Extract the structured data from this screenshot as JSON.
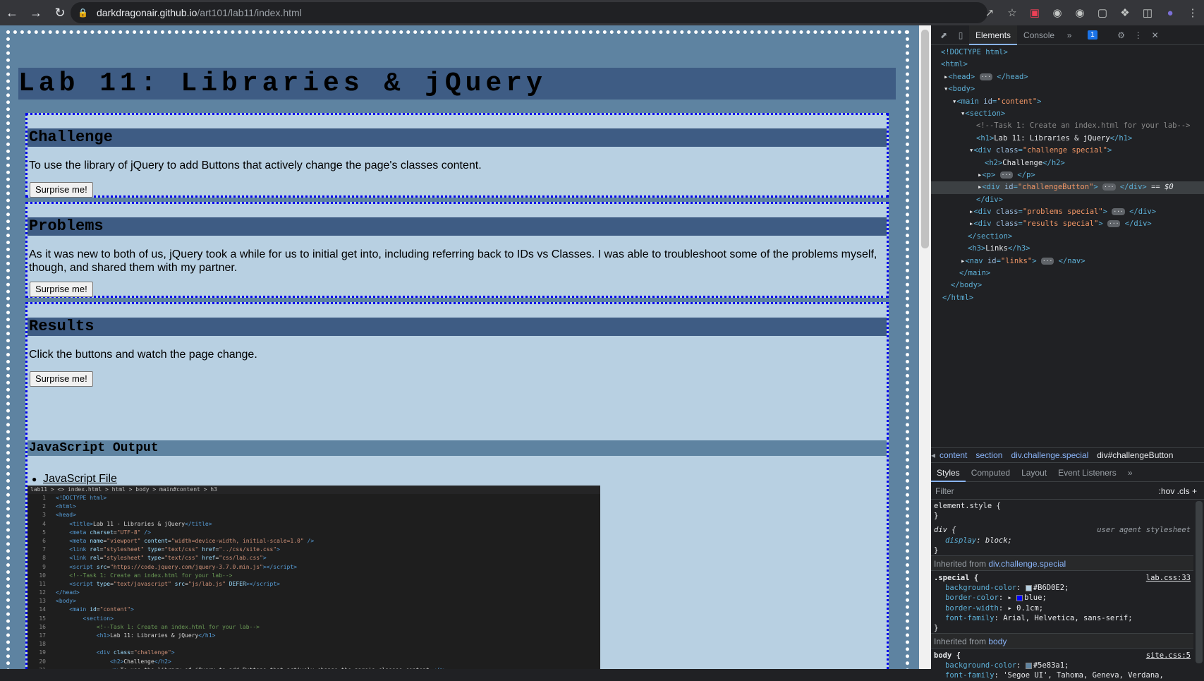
{
  "browser": {
    "url_host": "darkdragonair.github.io",
    "url_path": "/art101/lab11/index.html"
  },
  "page": {
    "title": "Lab 11: Libraries & jQuery",
    "sections": [
      {
        "heading": "Challenge",
        "text": "To use the library of jQuery to add Buttons that actively change the page's classes content.",
        "button": "Surprise me!"
      },
      {
        "heading": "Problems",
        "text": "As it was new to both of us, jQuery took a while for us to initial get into, including referring back to IDs vs Classes. I was able to troubleshoot some of the problems myself, though, and shared them with my partner.",
        "button": "Surprise me!"
      },
      {
        "heading": "Results",
        "text": "Click the buttons and watch the page change.",
        "button": "Surprise me!"
      }
    ],
    "js_output_heading": "JavaScript Output",
    "js_link": "JavaScript File",
    "code_breadcrumb": "lab11 > <> index.html > html > body > main#content > h3"
  },
  "devtools": {
    "tabs": [
      "Elements",
      "Console"
    ],
    "active_tab": "Elements",
    "issues_badge": "1",
    "breadcrumbs": [
      "content",
      "section",
      "div.challenge.special",
      "div#challengeButton"
    ],
    "style_tabs": [
      "Styles",
      "Computed",
      "Layout",
      "Event Listeners"
    ],
    "filter_placeholder": "Filter",
    "filter_tools": ":hov  .cls  +",
    "element_style": "element.style {",
    "div_rule": {
      "selector": "div {",
      "origin": "user agent stylesheet",
      "prop": "display",
      "value": "block;"
    },
    "inherited_1": {
      "label": "Inherited from ",
      "from": "div.challenge.special"
    },
    "special_rule": {
      "selector": ".special {",
      "source": "lab.css:33",
      "props": [
        {
          "prop": "background-color",
          "value": "#B6D0E2;",
          "swatch": "#B6D0E2"
        },
        {
          "prop": "border-color",
          "value": "blue;",
          "swatch": "#0000ff"
        },
        {
          "prop": "border-width",
          "value": "0.1cm;"
        },
        {
          "prop": "font-family",
          "value": "Arial, Helvetica, sans-serif;"
        }
      ]
    },
    "inherited_2": {
      "label": "Inherited from ",
      "from": "body"
    },
    "body_rule": {
      "selector": "body {",
      "source": "site.css:5",
      "props": [
        {
          "prop": "background-color",
          "value": "#5e83a1;",
          "swatch": "#5e83a1"
        },
        {
          "prop": "font-family",
          "value": "'Segoe UI', Tahoma, Geneva, Verdana,"
        }
      ]
    }
  },
  "colors": {
    "page_bg": "#5e83a1",
    "box_bg": "#b8d0e2",
    "heading_bg": "#3e5c84",
    "border": "#0000ee"
  }
}
